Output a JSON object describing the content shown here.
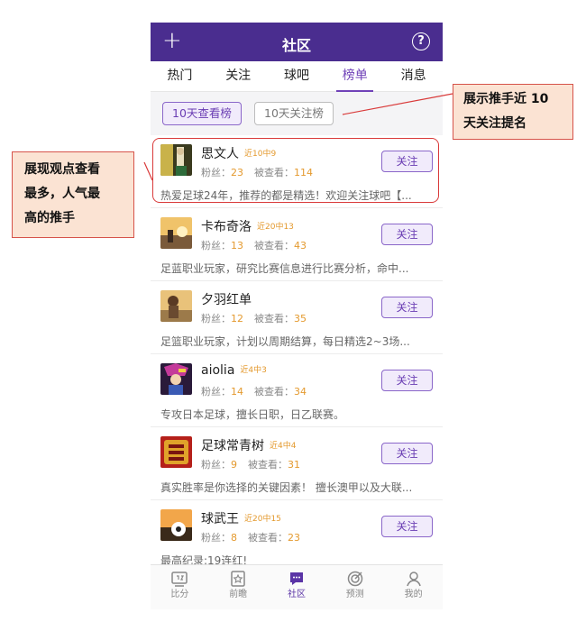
{
  "header": {
    "title": "社区",
    "plus": "+",
    "help": "?"
  },
  "tabs": [
    {
      "label": "热门",
      "active": false
    },
    {
      "label": "关注",
      "active": false
    },
    {
      "label": "球吧",
      "active": false
    },
    {
      "label": "榜单",
      "active": true
    },
    {
      "label": "消息",
      "active": false
    }
  ],
  "filters": {
    "primary": "10天查看榜",
    "secondary": "10天关注榜"
  },
  "list": {
    "fans_label": "粉丝：",
    "views_label": "被查看：",
    "follow_label": "关注",
    "items": [
      {
        "name": "思文人",
        "record": "近10中9",
        "fans": "23",
        "views": "114",
        "desc": "热爱足球24年，推荐的都是精选！欢迎关注球吧【..."
      },
      {
        "name": "卡布奇洛",
        "record": "近20中13",
        "fans": "13",
        "views": "43",
        "desc": "足蓝职业玩家，研究比赛信息进行比赛分析，命中..."
      },
      {
        "name": "夕羽红单",
        "record": "",
        "fans": "12",
        "views": "35",
        "desc": "足篮职业玩家，计划以周期结算，每日精选2~3场..."
      },
      {
        "name": "aiolia",
        "record": "近4中3",
        "fans": "14",
        "views": "34",
        "desc": "专攻日本足球，擅长日职，日乙联赛。"
      },
      {
        "name": "足球常青树",
        "record": "近4中4",
        "fans": "9",
        "views": "31",
        "desc": "真实胜率是你选择的关键因素！ 擅长澳甲以及大联..."
      },
      {
        "name": "球武王",
        "record": "近20中15",
        "fans": "8",
        "views": "23",
        "desc": "最高纪录:19连红!"
      }
    ]
  },
  "bottom_nav": [
    {
      "label": "比分",
      "icon": "scoreboard-icon",
      "active": false
    },
    {
      "label": "前瞻",
      "icon": "star-card-icon",
      "active": false
    },
    {
      "label": "社区",
      "icon": "chat-icon",
      "active": true
    },
    {
      "label": "预测",
      "icon": "target-icon",
      "active": false
    },
    {
      "label": "我的",
      "icon": "user-icon",
      "active": false
    }
  ],
  "annotations": {
    "right_line1": "展示推手近 10",
    "right_line2": "天关注提名",
    "left_line1": "展现观点查看",
    "left_line2": "最多，人气最",
    "left_line3": "高的推手"
  },
  "colors": {
    "accent": "#4a2d8f",
    "highlight_purple": "#7042b8",
    "orange": "#e49a2f",
    "annotation_border": "#d6534a",
    "annotation_fill": "#fbe3d3"
  }
}
